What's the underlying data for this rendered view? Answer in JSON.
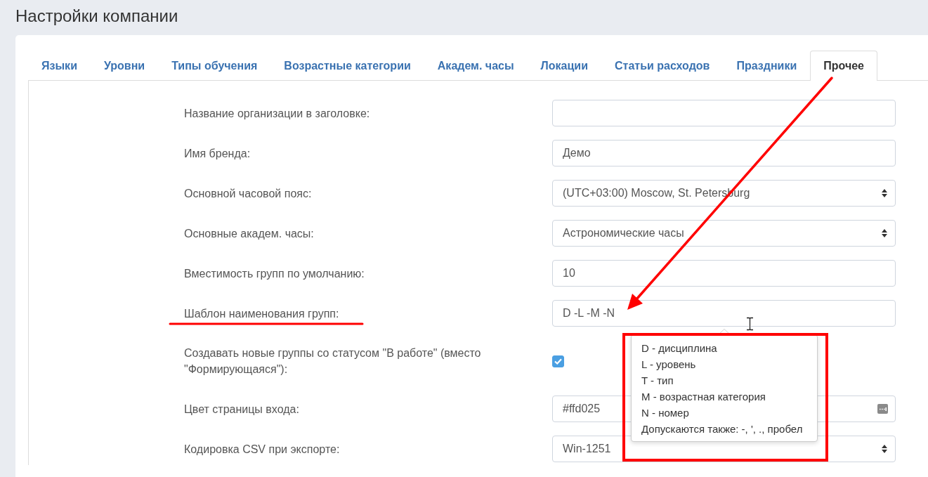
{
  "page": {
    "title": "Настройки компании"
  },
  "tabs": [
    {
      "label": "Языки",
      "selected": false
    },
    {
      "label": "Уровни",
      "selected": false
    },
    {
      "label": "Типы обучения",
      "selected": false
    },
    {
      "label": "Возрастные категории",
      "selected": false
    },
    {
      "label": "Академ. часы",
      "selected": false
    },
    {
      "label": "Локации",
      "selected": false
    },
    {
      "label": "Статьи расходов",
      "selected": false
    },
    {
      "label": "Праздники",
      "selected": false
    },
    {
      "label": "Прочее",
      "selected": true
    }
  ],
  "form": {
    "rows": [
      {
        "kind": "text",
        "label": "Название организации в заголовке:"
      },
      {
        "kind": "text",
        "label": "Имя бренда:",
        "value": "Демо"
      },
      {
        "kind": "select",
        "label": "Основной часовой пояс:",
        "value": "(UTC+03:00) Moscow, St. Petersburg"
      },
      {
        "kind": "select",
        "label": "Основные академ. часы:",
        "value": "Астрономические часы"
      },
      {
        "kind": "text",
        "label": "Вместимость групп по умолчанию:",
        "value": "10"
      },
      {
        "kind": "text",
        "label": "Шаблон наименования групп:",
        "value": "D -L -M -N",
        "tooltip": [
          "D - дисциплина",
          "L - уровень",
          "T - тип",
          "M - возрастная категория",
          "N - номер",
          "Допускаются также: -, ', ., пробел"
        ]
      },
      {
        "kind": "checkbox",
        "label": "Создавать новые группы со статусом \"В работе\" (вместо \"Формирующаяся\"):",
        "checked": true
      },
      {
        "kind": "color",
        "label": "Цвет страницы входа:",
        "value": "#ffd025"
      },
      {
        "kind": "select",
        "label": "Кодировка CSV при экспорте:",
        "value": "Win-1251"
      }
    ]
  },
  "annotations": [
    {
      "kind": "arrow"
    },
    {
      "kind": "underline"
    },
    {
      "kind": "frame"
    }
  ]
}
